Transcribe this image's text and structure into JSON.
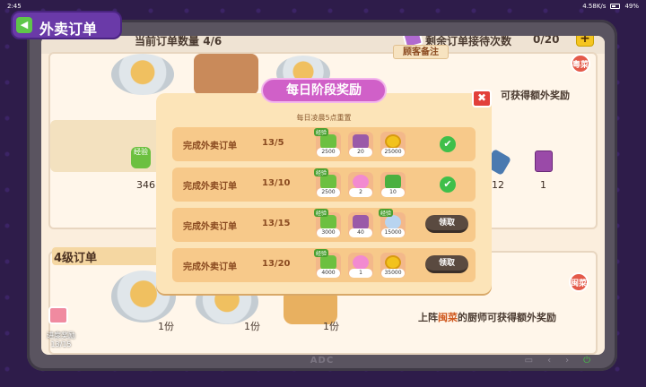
{
  "status": {
    "time": "2:45",
    "network": "4.58K/s",
    "battery": "49%"
  },
  "header": {
    "title": "外卖订单",
    "current_orders_label": "当前订单数量",
    "current_orders_value": "4/6",
    "remaining_label": "剩余订单接待次数",
    "remaining_value": "0/20",
    "add_label": "+"
  },
  "background": {
    "customer_note_label": "顾客备注",
    "note_top": "可获得额外奖励",
    "tag_top": "粤菜",
    "tag_bottom": "闽菜",
    "note_bottom_prefix": "上阵",
    "note_bottom_highlight": "闽菜",
    "note_bottom_suffix": "的厨师可获得额外奖励",
    "level_header": "4级订单",
    "exp_badge": "经验",
    "val_exp": "346",
    "val_12": "12",
    "val_1": "1",
    "portion": "1份",
    "progress_label": "进度奖励",
    "progress_value": "13/15",
    "brand": "ADC"
  },
  "modal": {
    "title": "每日阶段奖励",
    "subtitle": "每日凌晨5点重置",
    "close_label": "✖",
    "claim_label": "领取",
    "check_mark": "✔",
    "exp_tag": "经验",
    "rows": [
      {
        "task": "完成外卖订单",
        "progress": "13/5",
        "rewards": [
          "2500",
          "20",
          "25000"
        ],
        "state": "done"
      },
      {
        "task": "完成外卖订单",
        "progress": "13/10",
        "rewards": [
          "2500",
          "2",
          "10"
        ],
        "state": "done"
      },
      {
        "task": "完成外卖订单",
        "progress": "13/15",
        "rewards": [
          "3000",
          "40",
          "15000"
        ],
        "state": "claim"
      },
      {
        "task": "完成外卖订单",
        "progress": "13/20",
        "rewards": [
          "4000",
          "1",
          "35000"
        ],
        "state": "claim"
      }
    ]
  },
  "colors": {
    "accent": "#d060c8",
    "success": "#3fbf4a",
    "frame": "#5a5460"
  }
}
